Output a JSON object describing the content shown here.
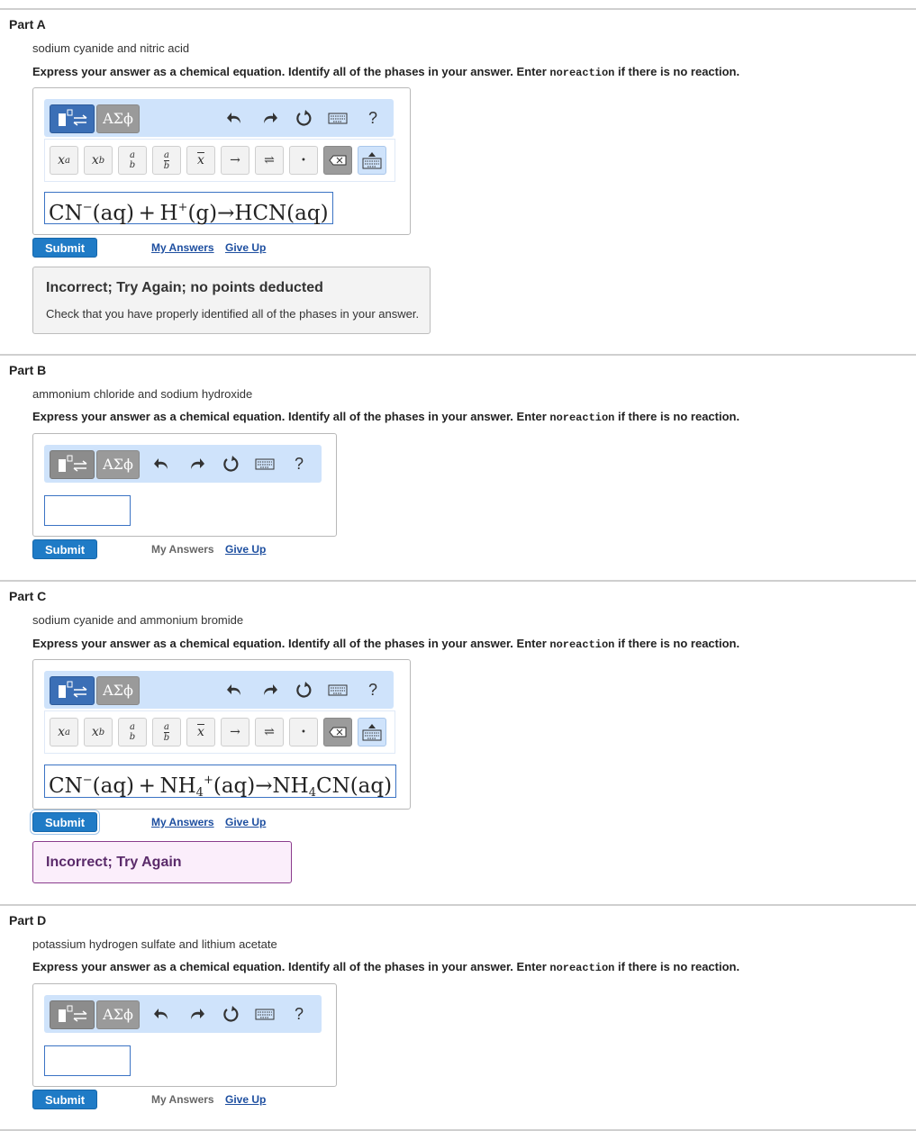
{
  "instructions": {
    "text_before": "Express your answer as a chemical equation. Identify all of the phases in your answer. Enter ",
    "code": "noreaction",
    "text_after": " if there is no reaction."
  },
  "toolbar": {
    "greek_label": "ΑΣϕ",
    "help_label": "?"
  },
  "keypad": {
    "superscript": "x",
    "superscript_exp": "a",
    "subscript": "x",
    "subscript_sub": "b",
    "fraction_num": "a",
    "fraction_den": "b",
    "mixed_num": "a",
    "mixed_den": "b",
    "overline": "x",
    "arrow": "→",
    "equilibrium": "⇌",
    "dot": "•"
  },
  "part_a": {
    "title": "Part A",
    "subtitle": "sodium cyanide and nitric acid",
    "answer": {
      "p1": "CN",
      "p1_sup": "−",
      "p2": "(aq) + H",
      "p2_sup": "+",
      "p3": "(g)→HCN(aq)"
    },
    "submit": "Submit",
    "my_answers": "My Answers",
    "give_up": "Give Up",
    "feedback_title": "Incorrect; Try Again; no points deducted",
    "feedback_text": "Check that you have properly identified all of the phases in your answer."
  },
  "part_b": {
    "title": "Part B",
    "subtitle": "ammonium chloride and sodium hydroxide",
    "submit": "Submit",
    "my_answers": "My Answers",
    "give_up": "Give Up"
  },
  "part_c": {
    "title": "Part C",
    "subtitle": "sodium cyanide and ammonium bromide",
    "answer": {
      "p1": "CN",
      "p1_sup": "−",
      "p2": "(aq) + NH",
      "p2_sub": "4",
      "p2_sup": "+",
      "p3": "(aq)→NH",
      "p3_sub": "4",
      "p4": "CN(aq)"
    },
    "submit": "Submit",
    "my_answers": "My Answers",
    "give_up": "Give Up",
    "feedback_title": "Incorrect; Try Again"
  },
  "part_d": {
    "title": "Part D",
    "subtitle": "potassium hydrogen sulfate and lithium acetate",
    "submit": "Submit",
    "my_answers": "My Answers",
    "give_up": "Give Up"
  }
}
